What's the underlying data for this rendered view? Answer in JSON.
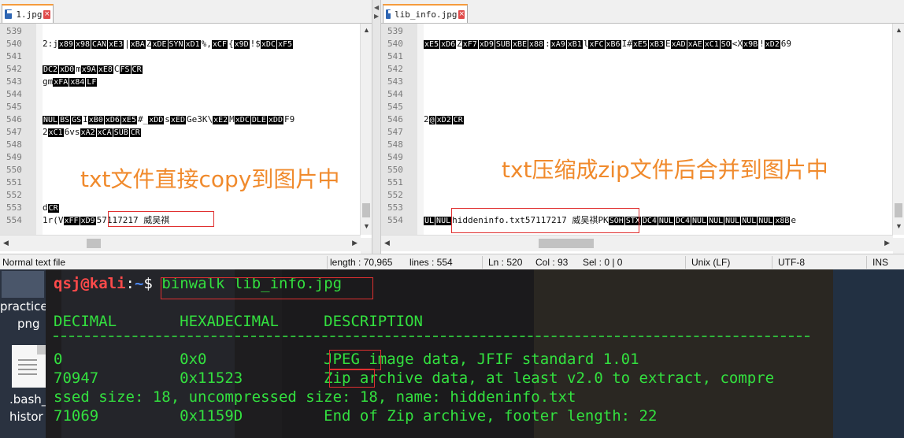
{
  "left_editor": {
    "tab_label": "1.jpg",
    "lines": [
      {
        "n": "539",
        "parts": []
      },
      {
        "n": "540",
        "parts": [
          {
            "t": "2:j"
          },
          {
            "c": "x89"
          },
          {
            "c": "x98"
          },
          {
            "c": "CAN"
          },
          {
            "c": "xE3"
          },
          {
            "t": "|"
          },
          {
            "c": "xBA"
          },
          {
            "t": "Z"
          },
          {
            "c": "xDE"
          },
          {
            "c": "SYN"
          },
          {
            "c": "xD1"
          },
          {
            "t": "%,"
          },
          {
            "c": "xCF"
          },
          {
            "t": "{"
          },
          {
            "c": "x9D"
          },
          {
            "t": "!$"
          },
          {
            "c": "xDC"
          },
          {
            "c": "xF5"
          }
        ]
      },
      {
        "n": "541",
        "parts": []
      },
      {
        "n": "542",
        "parts": [
          {
            "c": "DC2"
          },
          {
            "c": "xD0"
          },
          {
            "t": "m"
          },
          {
            "c": "x9A"
          },
          {
            "c": "xE8"
          },
          {
            "t": "C"
          },
          {
            "c": "FS"
          },
          {
            "c": "CR"
          }
        ]
      },
      {
        "n": "543",
        "parts": [
          {
            "t": "gm"
          },
          {
            "c": "xFA"
          },
          {
            "c": "x84"
          },
          {
            "c": "LF"
          }
        ]
      },
      {
        "n": "544",
        "parts": []
      },
      {
        "n": "545",
        "parts": []
      },
      {
        "n": "546",
        "parts": [
          {
            "c": "NUL"
          },
          {
            "c": "BS"
          },
          {
            "c": "GS"
          },
          {
            "t": "I"
          },
          {
            "c": "xB0"
          },
          {
            "c": "xD6"
          },
          {
            "c": "xE5"
          },
          {
            "t": "#_"
          },
          {
            "c": "xDD"
          },
          {
            "t": "s"
          },
          {
            "c": "xED"
          },
          {
            "t": "Ge3K\\"
          },
          {
            "c": "xE2"
          },
          {
            "t": "M"
          },
          {
            "c": "xDC"
          },
          {
            "c": "DLE"
          },
          {
            "c": "xDD"
          },
          {
            "t": "F9"
          }
        ]
      },
      {
        "n": "547",
        "parts": [
          {
            "t": "2"
          },
          {
            "c": "xC1"
          },
          {
            "t": "6vs"
          },
          {
            "c": "xA2"
          },
          {
            "c": "xCA"
          },
          {
            "c": "SUB"
          },
          {
            "c": "CR"
          }
        ]
      },
      {
        "n": "548",
        "parts": []
      },
      {
        "n": "549",
        "parts": []
      },
      {
        "n": "550",
        "parts": []
      },
      {
        "n": "551",
        "parts": []
      },
      {
        "n": "552",
        "parts": []
      },
      {
        "n": "553",
        "parts": [
          {
            "t": "d"
          },
          {
            "c": "CR"
          }
        ]
      },
      {
        "n": "554",
        "parts": [
          {
            "t": "1r(V"
          },
          {
            "c": "xFF"
          },
          {
            "c": "xD9"
          },
          {
            "t": "57117217 威吴祺"
          }
        ]
      }
    ],
    "annotation": "txt文件直接copy到图片中"
  },
  "right_editor": {
    "tab_label": "lib_info.jpg",
    "lines": [
      {
        "n": "539",
        "parts": []
      },
      {
        "n": "540",
        "parts": [
          {
            "c": "xE5"
          },
          {
            "c": "xD6"
          },
          {
            "t": "Z"
          },
          {
            "c": "xF7"
          },
          {
            "c": "xD9"
          },
          {
            "c": "SUB"
          },
          {
            "c": "xBE"
          },
          {
            "c": "x88"
          },
          {
            "t": ":"
          },
          {
            "c": "xA9"
          },
          {
            "c": "xB1"
          },
          {
            "t": "l"
          },
          {
            "c": "xFC"
          },
          {
            "c": "xB6"
          },
          {
            "t": "I#"
          },
          {
            "c": "xE5"
          },
          {
            "c": "xB3"
          },
          {
            "t": "E"
          },
          {
            "c": "xAD"
          },
          {
            "c": "xAE"
          },
          {
            "c": "xC1"
          },
          {
            "c": "SO"
          },
          {
            "t": "<X"
          },
          {
            "c": "x9B"
          },
          {
            "t": "!"
          },
          {
            "c": "xD2"
          },
          {
            "t": "69"
          }
        ]
      },
      {
        "n": "541",
        "parts": []
      },
      {
        "n": "542",
        "parts": []
      },
      {
        "n": "543",
        "parts": []
      },
      {
        "n": "544",
        "parts": []
      },
      {
        "n": "545",
        "parts": []
      },
      {
        "n": "546",
        "parts": [
          {
            "t": "2"
          },
          {
            "c": "@"
          },
          {
            "c": "xD2"
          },
          {
            "c": "CR"
          }
        ]
      },
      {
        "n": "547",
        "parts": []
      },
      {
        "n": "548",
        "parts": []
      },
      {
        "n": "549",
        "parts": []
      },
      {
        "n": "550",
        "parts": []
      },
      {
        "n": "551",
        "parts": []
      },
      {
        "n": "552",
        "parts": []
      },
      {
        "n": "553",
        "parts": []
      },
      {
        "n": "554",
        "parts": [
          {
            "c": "UL"
          },
          {
            "c": "NUL"
          },
          {
            "t": "hiddeninfo.txt57117217 威吴祺"
          },
          {
            "t": "PK"
          },
          {
            "c": "SOH"
          },
          {
            "c": "STX"
          },
          {
            "c": "DC4"
          },
          {
            "c": "NUL"
          },
          {
            "c": "DC4"
          },
          {
            "c": "NUL"
          },
          {
            "c": "NUL"
          },
          {
            "c": "NUL"
          },
          {
            "c": "NUL"
          },
          {
            "c": "NUL"
          },
          {
            "c": "x8B"
          },
          {
            "t": "e"
          }
        ]
      }
    ],
    "annotation": "txt压缩成zip文件后合并到图片中"
  },
  "statusbar": {
    "file_type": "Normal text file",
    "length": "length : 70,965",
    "lines": "lines : 554",
    "ln": "Ln : 520",
    "col": "Col : 93",
    "sel": "Sel : 0 | 0",
    "eol": "Unix (LF)",
    "encoding": "UTF-8",
    "mode": "INS"
  },
  "desktop": {
    "icon1_label_line1": "practice",
    "icon1_label_line2": "png",
    "icon2_label_line1": ".bash_",
    "icon2_label_line2": "histor"
  },
  "terminal": {
    "prompt_user": "qsj@kali",
    "prompt_sep": ":",
    "prompt_path": "~",
    "prompt_symbol": "$",
    "command": "binwalk lib_info.jpg",
    "header": "DECIMAL       HEXADECIMAL     DESCRIPTION",
    "rows": [
      "0             0x0             JPEG image data, JFIF standard 1.01",
      "70947         0x11523         Zip archive data, at least v2.0 to extract, compre",
      "ssed size: 18, uncompressed size: 18, name: hiddeninfo.txt",
      "71069         0x1159D         End of Zip archive, footer length: 22"
    ]
  },
  "colors": {
    "annotation": "#f08a2c",
    "highlight_box": "#e03030",
    "terminal_text": "#33e03f",
    "prompt_user": "#ff4a4a",
    "prompt_path": "#4d8bff",
    "tab_accent": "#f59b3c"
  }
}
